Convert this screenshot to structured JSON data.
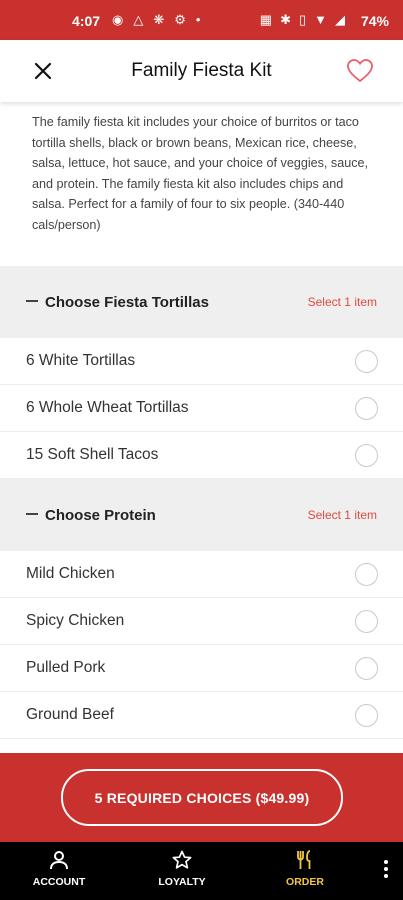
{
  "status": {
    "time": "4:07",
    "left_icons": [
      "discord-icon",
      "game-icon",
      "pinwheel-icon",
      "settings-icon",
      "dot-icon"
    ],
    "right_icons": [
      "nfc-icon",
      "bluetooth-icon",
      "vibrate-icon",
      "wifi-icon",
      "signal-icon"
    ],
    "battery": "74%"
  },
  "header": {
    "title": "Family Fiesta Kit"
  },
  "description": "The family fiesta kit includes your choice of burritos or taco tortilla shells, black or brown beans, Mexican rice, cheese, salsa, lettuce, hot sauce, and your choice of veggies, sauce, and protein. The family fiesta kit also includes chips and salsa. Perfect for a family of four to six people. (340-440 cals/person)",
  "sections": [
    {
      "title": "Choose Fiesta Tortillas",
      "requirement": "Select 1 item",
      "options": [
        "6 White Tortillas",
        "6 Whole Wheat Tortillas",
        "15 Soft Shell Tacos"
      ]
    },
    {
      "title": "Choose Protein",
      "requirement": "Select 1 item",
      "options": [
        "Mild Chicken",
        "Spicy Chicken",
        "Pulled Pork",
        "Ground Beef"
      ]
    }
  ],
  "cta": {
    "label": "5 REQUIRED CHOICES ($49.99)"
  },
  "nav": {
    "account": "ACCOUNT",
    "loyalty": "LOYALTY",
    "order": "ORDER"
  },
  "colors": {
    "brand_red": "#c8312d",
    "accent_red": "#e04a3f",
    "active_nav": "#f2c744"
  }
}
